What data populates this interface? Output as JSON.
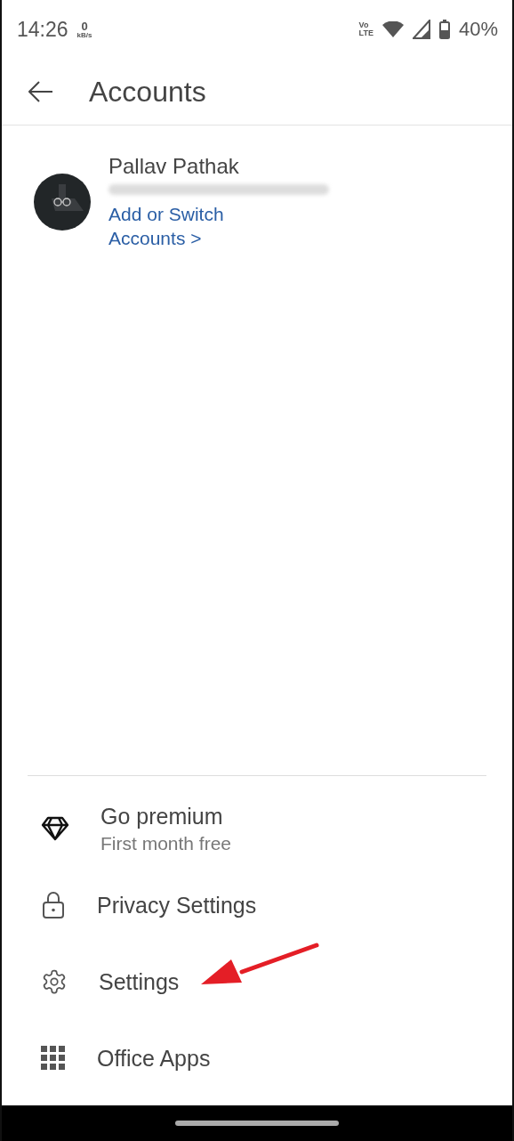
{
  "status_bar": {
    "time": "14:26",
    "speed_value": "0",
    "speed_unit": "kB/s",
    "network_label_top": "Vo",
    "network_label_bottom": "LTE",
    "battery": "40%"
  },
  "header": {
    "title": "Accounts"
  },
  "account": {
    "name": "Pallav Pathak",
    "link": "Add or Switch\nAccounts >"
  },
  "menu": [
    {
      "kind": "premium",
      "label": "Go premium",
      "sublabel": "First month free",
      "pointed": false
    },
    {
      "kind": "privacy",
      "label": "Privacy Settings",
      "pointed": false
    },
    {
      "kind": "settings",
      "label": "Settings",
      "pointed": true
    },
    {
      "kind": "apps",
      "label": "Office Apps",
      "pointed": false
    }
  ]
}
